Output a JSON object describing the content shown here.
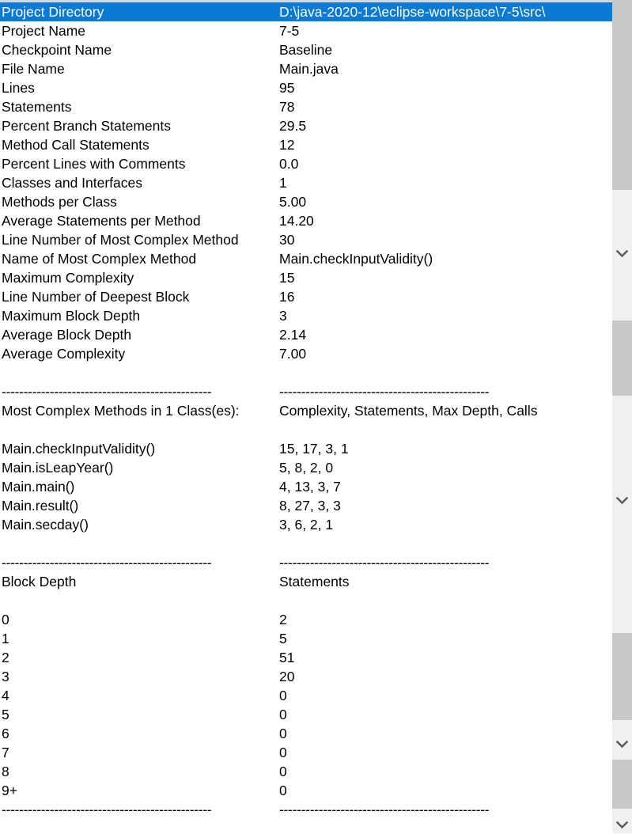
{
  "report": {
    "metrics": [
      {
        "label": "Project Directory",
        "value": "D:\\java-2020-12\\eclipse-workspace\\7-5\\src\\",
        "selected": true
      },
      {
        "label": "Project Name",
        "value": "7-5",
        "selected": false
      },
      {
        "label": "Checkpoint Name",
        "value": "Baseline",
        "selected": false
      },
      {
        "label": "File Name",
        "value": "Main.java",
        "selected": false
      },
      {
        "label": "Lines",
        "value": "95",
        "selected": false
      },
      {
        "label": "Statements",
        "value": "78",
        "selected": false
      },
      {
        "label": "Percent Branch Statements",
        "value": "29.5",
        "selected": false
      },
      {
        "label": "Method Call Statements",
        "value": "12",
        "selected": false
      },
      {
        "label": "Percent Lines with Comments",
        "value": "0.0",
        "selected": false
      },
      {
        "label": "Classes and Interfaces",
        "value": "1",
        "selected": false
      },
      {
        "label": "Methods per Class",
        "value": "5.00",
        "selected": false
      },
      {
        "label": "Average Statements per Method",
        "value": "14.20",
        "selected": false
      },
      {
        "label": "Line Number of Most Complex Method",
        "value": "30",
        "selected": false
      },
      {
        "label": "Name of Most Complex Method",
        "value": "Main.checkInputValidity()",
        "selected": false
      },
      {
        "label": "Maximum Complexity",
        "value": "15",
        "selected": false
      },
      {
        "label": "Line Number of Deepest Block",
        "value": "16",
        "selected": false
      },
      {
        "label": "Maximum Block Depth",
        "value": "3",
        "selected": false
      },
      {
        "label": "Average Block Depth",
        "value": "2.14",
        "selected": false
      },
      {
        "label": "Average Complexity",
        "value": "7.00",
        "selected": false
      }
    ],
    "rule_left": "------------------------------------------------",
    "rule_right": "------------------------------------------------",
    "complex_methods_section": {
      "header_label": "Most Complex Methods in 1 Class(es):",
      "header_value": "Complexity, Statements, Max Depth, Calls",
      "rows": [
        {
          "label": "Main.checkInputValidity()",
          "value": "15, 17, 3, 1"
        },
        {
          "label": "Main.isLeapYear()",
          "value": "5, 8, 2, 0"
        },
        {
          "label": "Main.main()",
          "value": "4, 13, 3, 7"
        },
        {
          "label": "Main.result()",
          "value": "8, 27, 3, 3"
        },
        {
          "label": "Main.secday()",
          "value": "3, 6, 2, 1"
        }
      ]
    },
    "block_depth_section": {
      "header_label": "Block Depth",
      "header_value": "Statements",
      "rows": [
        {
          "label": "0",
          "value": "2"
        },
        {
          "label": "1",
          "value": "5"
        },
        {
          "label": "2",
          "value": "51"
        },
        {
          "label": "3",
          "value": "20"
        },
        {
          "label": "4",
          "value": "0"
        },
        {
          "label": "5",
          "value": "0"
        },
        {
          "label": "6",
          "value": "0"
        },
        {
          "label": "7",
          "value": "0"
        },
        {
          "label": "8",
          "value": "0"
        },
        {
          "label": "9+",
          "value": "0"
        }
      ]
    }
  },
  "scrollbars": {
    "arrow_icon": "chevron-down-icon",
    "track_color": "#f0f0f0",
    "thumb_color": "#c8c8c8",
    "selection_color": "#0a7ad6"
  }
}
